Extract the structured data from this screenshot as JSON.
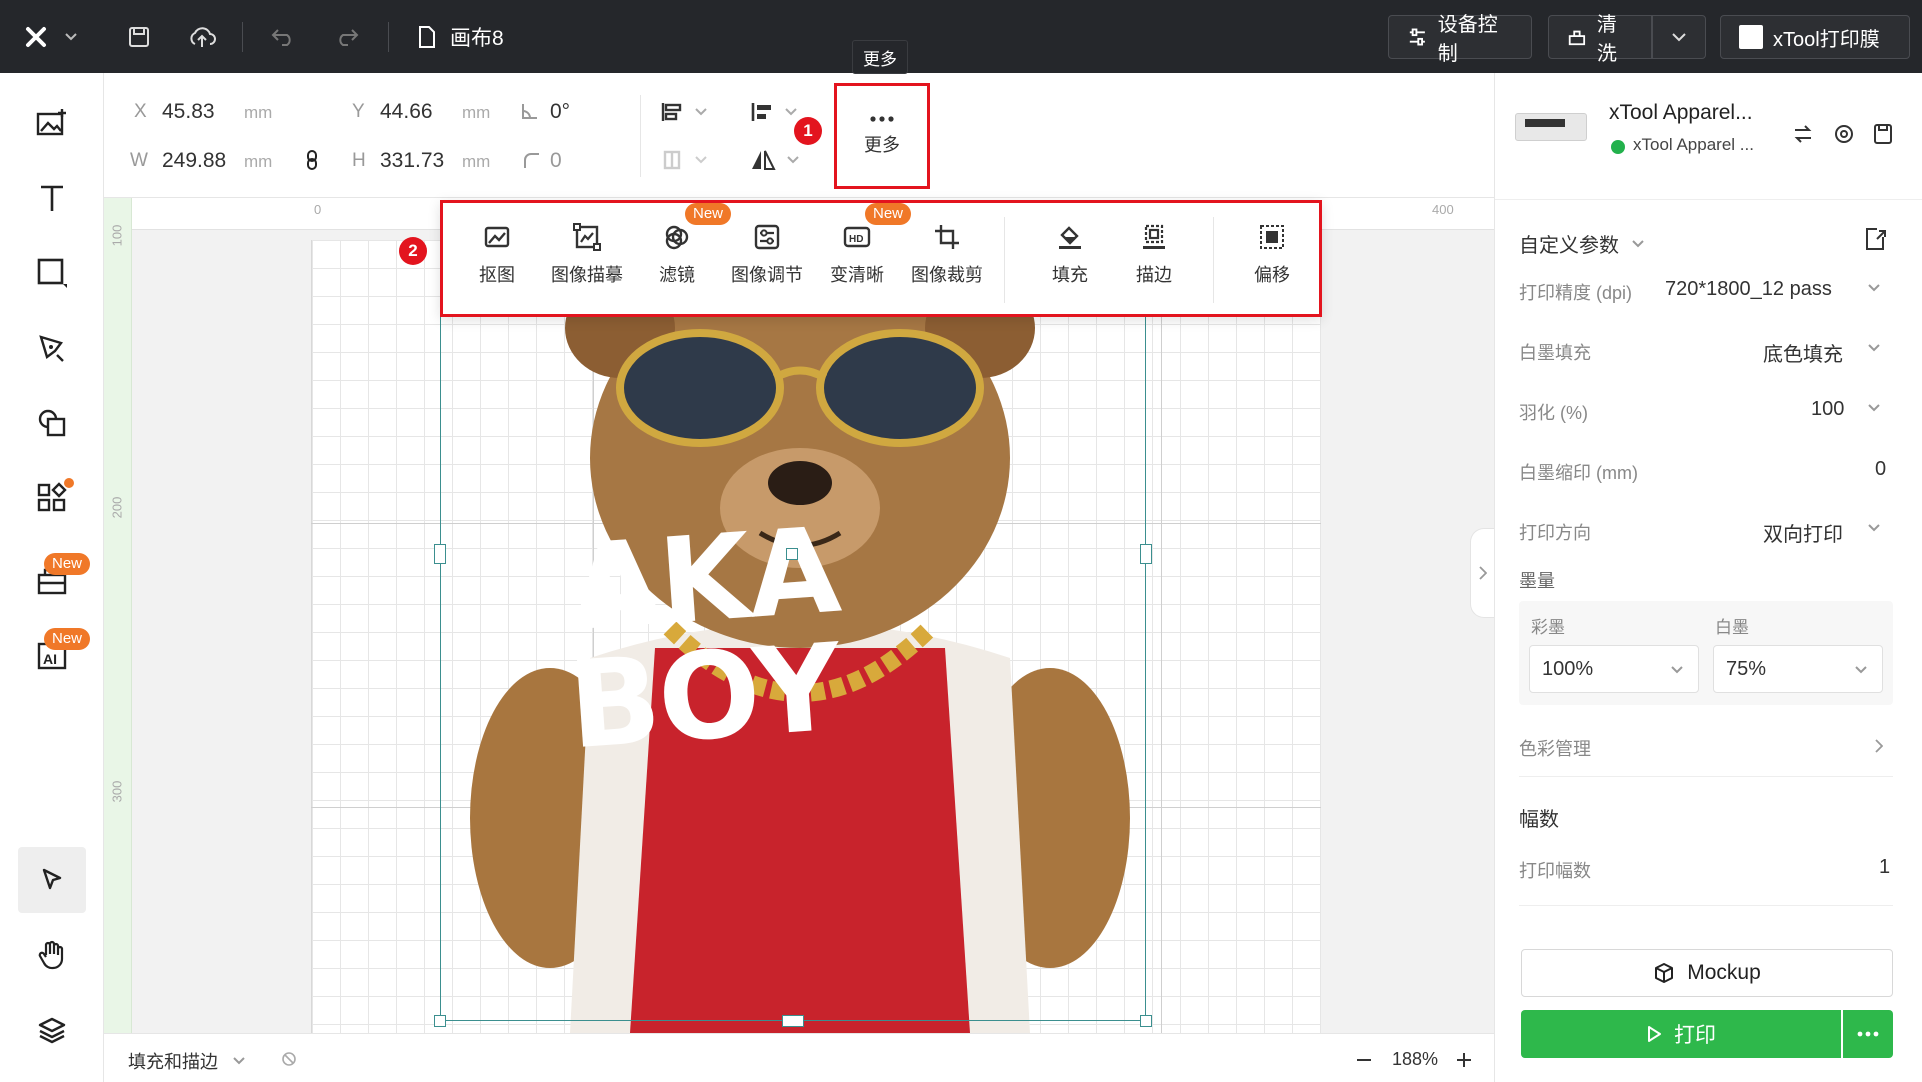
{
  "topbar": {
    "document_name": "画布8",
    "device_control_label": "设备控制",
    "clean_label": "清洗",
    "print_film_label": "xTool打印膜"
  },
  "lefttoolbar": {
    "new_badge_1": "New",
    "new_badge_2": "New"
  },
  "props": {
    "x_label": "X",
    "x_value": "45.83",
    "x_unit": "mm",
    "y_label": "Y",
    "y_value": "44.66",
    "y_unit": "mm",
    "angle_value": "0°",
    "w_label": "W",
    "w_value": "249.88",
    "w_unit": "mm",
    "h_label": "H",
    "h_value": "331.73",
    "h_unit": "mm",
    "radius_value": "0",
    "more_label": "更多",
    "more_tooltip": "更多"
  },
  "popup": {
    "items": [
      {
        "label": "抠图",
        "icon": "cutout-icon"
      },
      {
        "label": "图像描摹",
        "icon": "trace-icon"
      },
      {
        "label": "滤镜",
        "icon": "filter-icon",
        "badge": "New"
      },
      {
        "label": "图像调节",
        "icon": "adjust-icon"
      },
      {
        "label": "变清晰",
        "icon": "hd-icon",
        "badge": "New"
      },
      {
        "label": "图像裁剪",
        "icon": "crop-icon"
      },
      {
        "label": "填充",
        "icon": "fill-icon"
      },
      {
        "label": "描边",
        "icon": "stroke-icon"
      },
      {
        "label": "偏移",
        "icon": "offset-icon"
      }
    ]
  },
  "steps": {
    "one": "1",
    "two": "2"
  },
  "ruler": {
    "top_0": "0",
    "top_400": "400",
    "left_100": "100",
    "left_200": "200",
    "left_300": "300"
  },
  "artwork": {
    "shirt_line1": "AKA",
    "shirt_line2": "BOY"
  },
  "bottombar": {
    "mode_label": "填充和描边",
    "zoom": "188%"
  },
  "rightpanel": {
    "device_name": "xTool Apparel...",
    "device_status": "xTool Apparel ...",
    "status_color": "#22b14c",
    "section_custom": "自定义参数",
    "dpi_label": "打印精度 (dpi)",
    "dpi_value": "720*1800_12 pass",
    "white_fill_label": "白墨填充",
    "white_fill_value": "底色填充",
    "feather_label": "羽化 (%)",
    "feather_value": "100",
    "white_shrink_label": "白墨缩印 (mm)",
    "white_shrink_value": "0",
    "direction_label": "打印方向",
    "direction_value": "双向打印",
    "ink_label": "墨量",
    "color_ink_label": "彩墨",
    "color_ink_value": "100%",
    "white_ink_label": "白墨",
    "white_ink_value": "75%",
    "color_mgmt_label": "色彩管理",
    "copies_section": "幅数",
    "copies_label": "打印幅数",
    "copies_value": "1",
    "mockup_label": "Mockup",
    "print_label": "打印",
    "print_color": "#2eb84b",
    "accent_red": "#e3141e"
  }
}
